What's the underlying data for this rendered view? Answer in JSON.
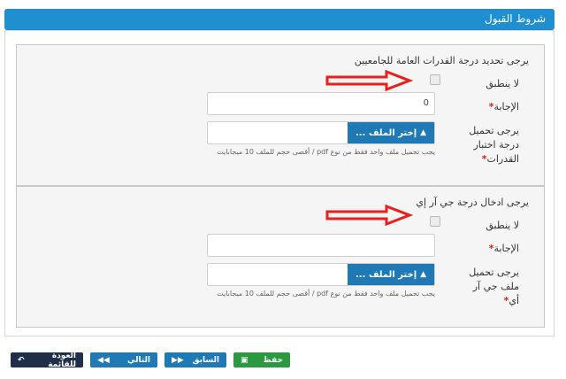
{
  "header": {
    "title": "شروط القبول"
  },
  "sections": [
    {
      "question": "يرجى تحديد درجة القدرات العامة للجامعيين",
      "not_applicable_label": "لا ينطبق",
      "answer_label": "الإجابة",
      "answer_value": "0",
      "upload_label": "يرجى تحميل درجة اختبار القدرات",
      "file_button_label": "إختر الملف ...",
      "hint": "يجب تحميل ملف واحد فقط من نوع pdf / أقصى حجم للملف 10 ميجابايت"
    },
    {
      "question": "يرجى ادخال درجة جي آر إي",
      "not_applicable_label": "لا ينطبق",
      "answer_label": "الإجابة",
      "answer_value": "",
      "upload_label": "يرجى تحميل ملف جي آر أي",
      "file_button_label": "إختر الملف ...",
      "hint": "يجب تحميل ملف واحد فقط من نوع pdf / أقصى حجم للملف 10 ميجابايت"
    }
  ],
  "footer": {
    "save_label": "حفظ",
    "prev_label": "السابق",
    "next_label": "التالي",
    "back_label": "العودة للقائمة"
  },
  "colors": {
    "header": "#1f8fd0",
    "primary_button": "#1f79b5",
    "save_button": "#2a9940",
    "back_button": "#1f2f4a",
    "required": "#d9231a",
    "arrow": "#e8201c"
  }
}
